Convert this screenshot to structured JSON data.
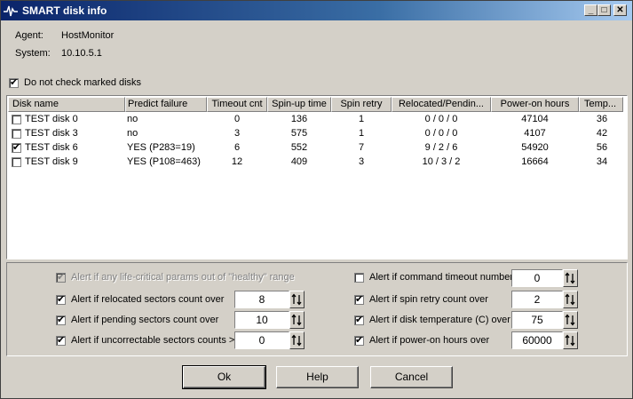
{
  "window": {
    "title": "SMART disk info"
  },
  "info": {
    "agent_label": "Agent:",
    "agent_value": "HostMonitor",
    "system_label": "System:",
    "system_value": "10.10.5.1"
  },
  "do_not_check": {
    "label": "Do not check marked disks",
    "checked": true
  },
  "columns": [
    "Disk name",
    "Predict failure",
    "Timeout cnt",
    "Spin-up time",
    "Spin retry",
    "Relocated/Pendin...",
    "Power-on hours",
    "Temp..."
  ],
  "disks": [
    {
      "name": "TEST disk 0",
      "checked": false,
      "predict": "no",
      "timeout": "0",
      "spinup": "136",
      "spinretry": "1",
      "relocated": "0 / 0 / 0",
      "poweron": "47104",
      "temp": "36"
    },
    {
      "name": "TEST disk 3",
      "checked": false,
      "predict": "no",
      "timeout": "3",
      "spinup": "575",
      "spinretry": "1",
      "relocated": "0 / 0 / 0",
      "poweron": "4107",
      "temp": "42"
    },
    {
      "name": "TEST disk 6",
      "checked": true,
      "predict": "YES (P283=19)",
      "timeout": "6",
      "spinup": "552",
      "spinretry": "7",
      "relocated": "9 / 2 / 6",
      "poweron": "54920",
      "temp": "56"
    },
    {
      "name": "TEST disk 9",
      "checked": false,
      "predict": "YES (P108=463)",
      "timeout": "12",
      "spinup": "409",
      "spinretry": "3",
      "relocated": "10 / 3 / 2",
      "poweron": "16664",
      "temp": "34"
    }
  ],
  "alerts": {
    "life_critical": {
      "label": "Alert if any life-critical params out of \"healthy\" range",
      "checked": true,
      "disabled": true
    },
    "relocated": {
      "label": "Alert if relocated sectors count over",
      "checked": true,
      "value": "8"
    },
    "pending": {
      "label": "Alert if pending sectors count over",
      "checked": true,
      "value": "10"
    },
    "uncorrectable": {
      "label": "Alert if uncorrectable sectors counts >",
      "checked": true,
      "value": "0"
    },
    "cmd_timeout": {
      "label": "Alert if command timeout number",
      "checked": false,
      "value": "0"
    },
    "spin_retry": {
      "label": "Alert if spin retry count over",
      "checked": true,
      "value": "2"
    },
    "temperature": {
      "label": "Alert if disk temperature (C) over",
      "checked": true,
      "value": "75"
    },
    "power_on": {
      "label": "Alert if power-on hours over",
      "checked": true,
      "value": "60000"
    }
  },
  "buttons": {
    "ok": "Ok",
    "help": "Help",
    "cancel": "Cancel"
  }
}
